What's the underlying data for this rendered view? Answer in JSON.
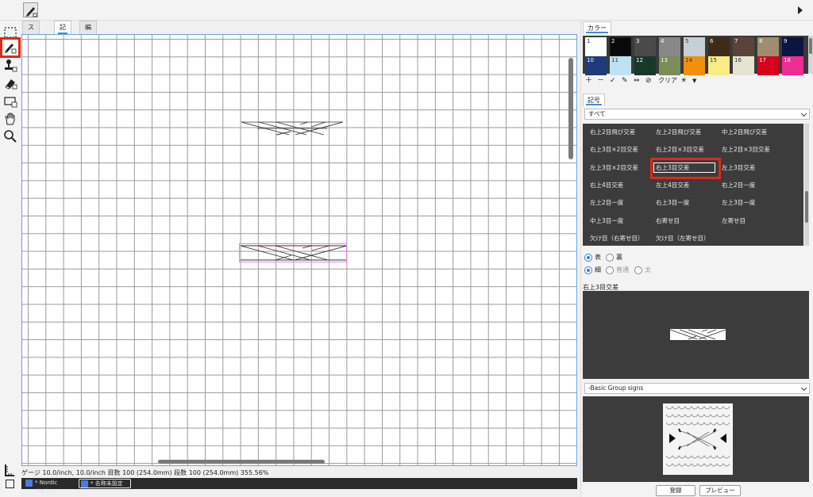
{
  "tabs": [
    "ステッチ",
    "記号",
    "編み上げ"
  ],
  "status_text": "ゲージ 10.0/inch, 10.0/inch  目数 100 (254.0mm)  段数 100 (254.0mm)    355.56%",
  "documents": [
    "* Nordic design...",
    "* 名称未設定"
  ],
  "panel": {
    "color_tab": "カラー",
    "swatches": [
      {
        "n": "1",
        "c": "#ffffff",
        "t": "#333333"
      },
      {
        "n": "2",
        "c": "#0a0a0a",
        "t": "#ffffff"
      },
      {
        "n": "3",
        "c": "#4a4a4a",
        "t": "#ffffff"
      },
      {
        "n": "4",
        "c": "#888888",
        "t": "#ffffff"
      },
      {
        "n": "5",
        "c": "#c5cfd6",
        "t": "#333333"
      },
      {
        "n": "6",
        "c": "#3e2b19",
        "t": "#ffffff"
      },
      {
        "n": "7",
        "c": "#5b433a",
        "t": "#ffffff"
      },
      {
        "n": "8",
        "c": "#a08d70",
        "t": "#ffffff"
      },
      {
        "n": "9",
        "c": "#0c1540",
        "t": "#ffffff"
      },
      {
        "n": "10",
        "c": "#1f3a7a",
        "t": "#ffffff"
      },
      {
        "n": "11",
        "c": "#bfe2f2",
        "t": "#333333"
      },
      {
        "n": "12",
        "c": "#16392a",
        "t": "#ffffff"
      },
      {
        "n": "13",
        "c": "#7c8c5a",
        "t": "#ffffff"
      },
      {
        "n": "14",
        "c": "#f0900c",
        "t": "#333333"
      },
      {
        "n": "15",
        "c": "#f7ec86",
        "t": "#333333"
      },
      {
        "n": "16",
        "c": "#e7e3d2",
        "t": "#333333"
      },
      {
        "n": "17",
        "c": "#d9001e",
        "t": "#ffffff"
      },
      {
        "n": "18",
        "c": "#ec2d91",
        "t": "#ffffff"
      }
    ],
    "clear_label": "クリア",
    "symbol_tab": "記号",
    "category_select": "すべて",
    "symbols": [
      [
        "右上2目飛び交差",
        "左上2目飛び交差",
        "中上2目飛び交差"
      ],
      [
        "右上3目×2目交差",
        "右上2目×3目交差",
        "左上2目×3目交差"
      ],
      [
        "左上3目×2目交差",
        "右上3目交差",
        "左上3目交差"
      ],
      [
        "右上4目交差",
        "左上4目交差",
        "右上2目一度"
      ],
      [
        "左上2目一度",
        "右上3目一度",
        "左上3目一度"
      ],
      [
        "中上3目一度",
        "右寄せ目",
        "左寄せ目"
      ],
      [
        "欠け目（右寄せ目）",
        "欠け目（左寄せ目）",
        ""
      ]
    ],
    "radio_face": [
      "表",
      "裏"
    ],
    "radio_width": [
      "細",
      "普通",
      "太"
    ],
    "selected_symbol_name": "右上3目交差",
    "group_select": "-Basic Group signs",
    "register_button": "登録",
    "preview_button": "プレビュー"
  }
}
